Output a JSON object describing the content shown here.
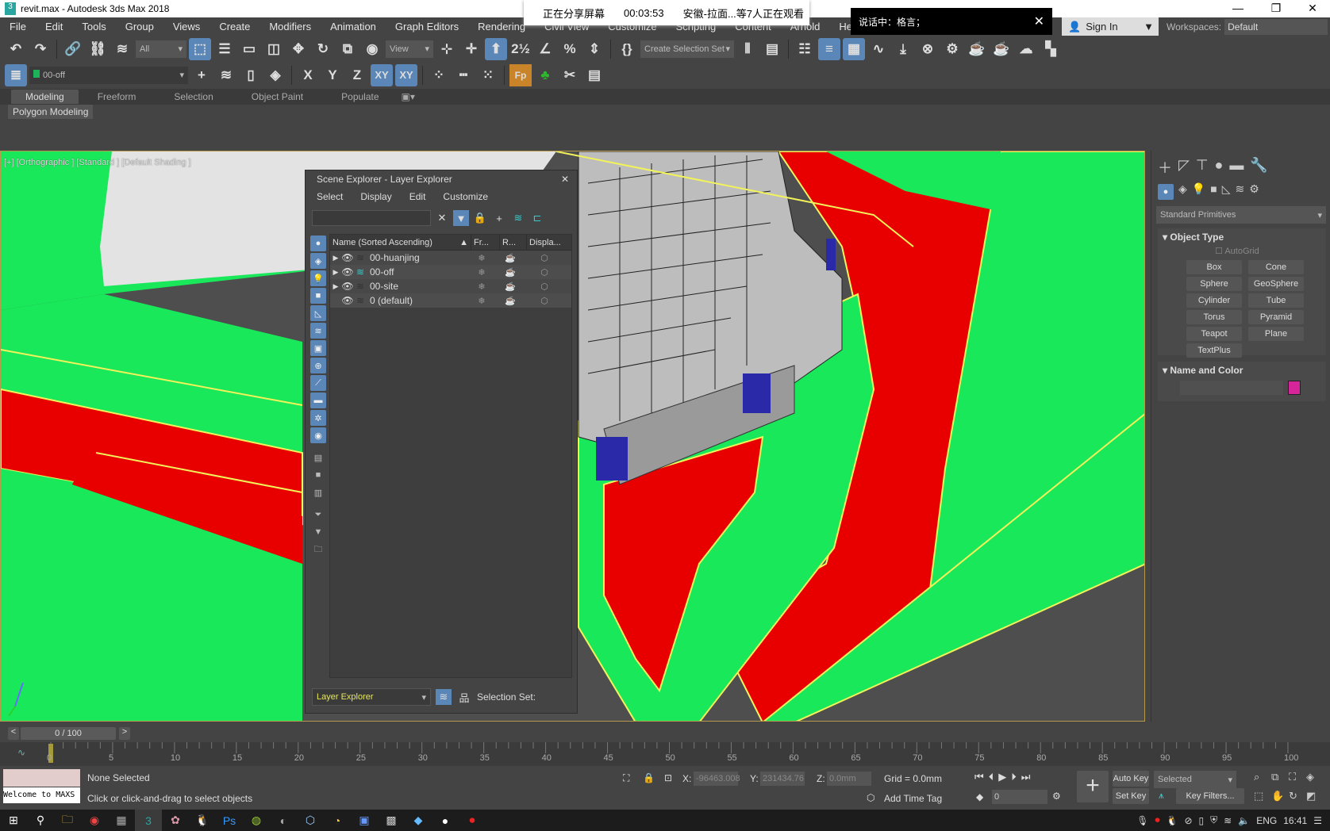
{
  "window": {
    "title": "revit.max - Autodesk 3ds Max 2018",
    "controls": [
      "—",
      "❐",
      "✕"
    ]
  },
  "overlay": {
    "sharing": "正在分享屏幕",
    "timer": "00:03:53",
    "viewers": "安徽-拉面...等7人正在观看",
    "speaking": "说话中：格言；",
    "close": "✕"
  },
  "menu": [
    "File",
    "Edit",
    "Tools",
    "Group",
    "Views",
    "Create",
    "Modifiers",
    "Animation",
    "Graph Editors",
    "Rendering",
    "Civil View",
    "Customize",
    "Scripting",
    "Content",
    "Arnold",
    "Help"
  ],
  "account": {
    "sign_in": "Sign In",
    "workspaces_label": "Workspaces:",
    "workspace": "Default"
  },
  "toolbar": {
    "selection_filter": "All",
    "ref_coord": "View",
    "selection_set": "Create Selection Set",
    "layer": "00-off",
    "axes": [
      "X",
      "Y",
      "Z",
      "XY",
      "XY"
    ],
    "fp": "Fp"
  },
  "ribbon": {
    "tabs": [
      "Modeling",
      "Freeform",
      "Selection",
      "Object Paint",
      "Populate"
    ],
    "active": "Modeling",
    "panel": "Polygon Modeling"
  },
  "viewport": {
    "label": "[+] [Orthographic ] [Standard ] [Default Shading ]",
    "colors": {
      "green": "#19e85a",
      "red": "#e80000",
      "outline": "#f2f25a",
      "building": "#bdbdbd"
    }
  },
  "scene_explorer": {
    "title": "Scene Explorer - Layer Explorer",
    "close": "✕",
    "menu": [
      "Select",
      "Display",
      "Edit",
      "Customize"
    ],
    "search_value": "",
    "columns": [
      "Name (Sorted Ascending)",
      "Fr...",
      "R...",
      "Displa..."
    ],
    "layers": [
      {
        "name": "00-huanjing",
        "expandable": true,
        "active": false
      },
      {
        "name": "00-off",
        "expandable": true,
        "active": true
      },
      {
        "name": "00-site",
        "expandable": true,
        "active": false
      },
      {
        "name": "0 (default)",
        "expandable": false,
        "active": false
      }
    ],
    "mode": "Layer Explorer",
    "selection_set_label": "Selection Set:"
  },
  "command_panel": {
    "category": "Standard Primitives",
    "object_type_title": "Object Type",
    "autogrid": "AutoGrid",
    "buttons": [
      "Box",
      "Cone",
      "Sphere",
      "GeoSphere",
      "Cylinder",
      "Tube",
      "Torus",
      "Pyramid",
      "Teapot",
      "Plane",
      "TextPlus"
    ],
    "name_color_title": "Name and Color",
    "name_value": "",
    "object_color": "#d6259a"
  },
  "timeline": {
    "frame": "0 / 100",
    "prev": "<",
    "next": ">",
    "ticks": [
      "0",
      "5",
      "10",
      "15",
      "20",
      "25",
      "30",
      "35",
      "40",
      "45",
      "50",
      "55",
      "60",
      "65",
      "70",
      "75",
      "80",
      "85",
      "90",
      "95",
      "100"
    ]
  },
  "status": {
    "selection": "None Selected",
    "prompt": "Click or click-and-drag to select objects",
    "maxscript": "Welcome to MAXS",
    "x_label": "X:",
    "x": "-96463.008",
    "y_label": "Y:",
    "y": "231434.76",
    "z_label": "Z:",
    "z": "0.0mm",
    "grid": "Grid = 0.0mm",
    "add_time_tag": "Add Time Tag",
    "current_frame": "0",
    "auto_key": "Auto Key",
    "set_key": "Set Key",
    "key_mode": "Selected",
    "key_filters": "Key Filters..."
  },
  "taskbar": {
    "lang": "ENG",
    "time": "16:41"
  }
}
